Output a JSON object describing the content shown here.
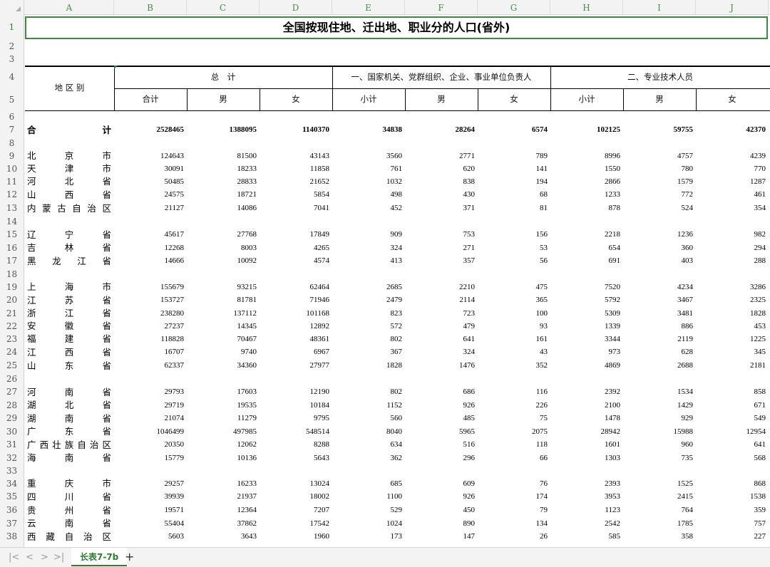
{
  "columns": [
    "A",
    "B",
    "C",
    "D",
    "E",
    "F",
    "G",
    "H",
    "I",
    "J"
  ],
  "row_numbers": [
    "1",
    "2",
    "3",
    "4",
    "5",
    "6",
    "7",
    "8",
    "9",
    "10",
    "11",
    "12",
    "13",
    "14",
    "15",
    "16",
    "17",
    "18",
    "19",
    "20",
    "21",
    "22",
    "23",
    "24",
    "25",
    "26",
    "27",
    "28",
    "29",
    "30",
    "31",
    "32",
    "33",
    "34",
    "35",
    "36",
    "37",
    "38"
  ],
  "title": "全国按现住地、迁出地、职业分的人口(省外)",
  "header": {
    "region_label": "地 区 别",
    "group_total": "总　计",
    "group_1": "一、国家机关、党群组织、企业、事业单位负责人",
    "group_2": "二、专业技术人员",
    "sub": [
      "合计",
      "男",
      "女",
      "小计",
      "男",
      "女",
      "小计",
      "男",
      "女"
    ]
  },
  "total_row": {
    "label_left": "合",
    "label_right": "计",
    "values": [
      "2528465",
      "1388095",
      "1140370",
      "34838",
      "28264",
      "6574",
      "102125",
      "59755",
      "42370"
    ]
  },
  "rows": [
    {
      "chars": [
        "北",
        "京",
        "市"
      ],
      "values": [
        "124643",
        "81500",
        "43143",
        "3560",
        "2771",
        "789",
        "8996",
        "4757",
        "4239"
      ]
    },
    {
      "chars": [
        "天",
        "津",
        "市"
      ],
      "values": [
        "30091",
        "18233",
        "11858",
        "761",
        "620",
        "141",
        "1550",
        "780",
        "770"
      ]
    },
    {
      "chars": [
        "河",
        "北",
        "省"
      ],
      "values": [
        "50485",
        "28833",
        "21652",
        "1032",
        "838",
        "194",
        "2866",
        "1579",
        "1287"
      ]
    },
    {
      "chars": [
        "山",
        "西",
        "省"
      ],
      "values": [
        "24575",
        "18721",
        "5854",
        "498",
        "430",
        "68",
        "1233",
        "772",
        "461"
      ]
    },
    {
      "chars": [
        "内",
        "蒙",
        "古",
        "自",
        "治",
        "区"
      ],
      "values": [
        "21127",
        "14086",
        "7041",
        "452",
        "371",
        "81",
        "878",
        "524",
        "354"
      ]
    },
    {
      "chars": [
        "辽",
        "宁",
        "省"
      ],
      "values": [
        "45617",
        "27768",
        "17849",
        "909",
        "753",
        "156",
        "2218",
        "1236",
        "982"
      ]
    },
    {
      "chars": [
        "吉",
        "林",
        "省"
      ],
      "values": [
        "12268",
        "8003",
        "4265",
        "324",
        "271",
        "53",
        "654",
        "360",
        "294"
      ]
    },
    {
      "chars": [
        "黑",
        "龙",
        "江",
        "省"
      ],
      "values": [
        "14666",
        "10092",
        "4574",
        "413",
        "357",
        "56",
        "691",
        "403",
        "288"
      ]
    },
    {
      "chars": [
        "上",
        "海",
        "市"
      ],
      "values": [
        "155679",
        "93215",
        "62464",
        "2685",
        "2210",
        "475",
        "7520",
        "4234",
        "3286"
      ]
    },
    {
      "chars": [
        "江",
        "苏",
        "省"
      ],
      "values": [
        "153727",
        "81781",
        "71946",
        "2479",
        "2114",
        "365",
        "5792",
        "3467",
        "2325"
      ]
    },
    {
      "chars": [
        "浙",
        "江",
        "省"
      ],
      "values": [
        "238280",
        "137112",
        "101168",
        "823",
        "723",
        "100",
        "5309",
        "3481",
        "1828"
      ]
    },
    {
      "chars": [
        "安",
        "徽",
        "省"
      ],
      "values": [
        "27237",
        "14345",
        "12892",
        "572",
        "479",
        "93",
        "1339",
        "886",
        "453"
      ]
    },
    {
      "chars": [
        "福",
        "建",
        "省"
      ],
      "values": [
        "118828",
        "70467",
        "48361",
        "802",
        "641",
        "161",
        "3344",
        "2119",
        "1225"
      ]
    },
    {
      "chars": [
        "江",
        "西",
        "省"
      ],
      "values": [
        "16707",
        "9740",
        "6967",
        "367",
        "324",
        "43",
        "973",
        "628",
        "345"
      ]
    },
    {
      "chars": [
        "山",
        "东",
        "省"
      ],
      "values": [
        "62337",
        "34360",
        "27977",
        "1828",
        "1476",
        "352",
        "4869",
        "2688",
        "2181"
      ]
    },
    {
      "chars": [
        "河",
        "南",
        "省"
      ],
      "values": [
        "29793",
        "17603",
        "12190",
        "802",
        "686",
        "116",
        "2392",
        "1534",
        "858"
      ]
    },
    {
      "chars": [
        "湖",
        "北",
        "省"
      ],
      "values": [
        "29719",
        "19535",
        "10184",
        "1152",
        "926",
        "226",
        "2100",
        "1429",
        "671"
      ]
    },
    {
      "chars": [
        "湖",
        "南",
        "省"
      ],
      "values": [
        "21074",
        "11279",
        "9795",
        "560",
        "485",
        "75",
        "1478",
        "929",
        "549"
      ]
    },
    {
      "chars": [
        "广",
        "东",
        "省"
      ],
      "values": [
        "1046499",
        "497985",
        "548514",
        "8040",
        "5965",
        "2075",
        "28942",
        "15988",
        "12954"
      ]
    },
    {
      "chars": [
        "广",
        "西",
        "壮",
        "族",
        "自",
        "治",
        "区"
      ],
      "values": [
        "20350",
        "12062",
        "8288",
        "634",
        "516",
        "118",
        "1601",
        "960",
        "641"
      ]
    },
    {
      "chars": [
        "海",
        "南",
        "省"
      ],
      "values": [
        "15779",
        "10136",
        "5643",
        "362",
        "296",
        "66",
        "1303",
        "735",
        "568"
      ]
    },
    {
      "chars": [
        "重",
        "庆",
        "市"
      ],
      "values": [
        "29257",
        "16233",
        "13024",
        "685",
        "609",
        "76",
        "2393",
        "1525",
        "868"
      ]
    },
    {
      "chars": [
        "四",
        "川",
        "省"
      ],
      "values": [
        "39939",
        "21937",
        "18002",
        "1100",
        "926",
        "174",
        "3953",
        "2415",
        "1538"
      ]
    },
    {
      "chars": [
        "贵",
        "州",
        "省"
      ],
      "values": [
        "19571",
        "12364",
        "7207",
        "529",
        "450",
        "79",
        "1123",
        "764",
        "359"
      ]
    },
    {
      "chars": [
        "云",
        "南",
        "省"
      ],
      "values": [
        "55404",
        "37862",
        "17542",
        "1024",
        "890",
        "134",
        "2542",
        "1785",
        "757"
      ]
    },
    {
      "chars": [
        "西",
        "藏",
        "自",
        "治",
        "区"
      ],
      "values": [
        "5603",
        "3643",
        "1960",
        "173",
        "147",
        "26",
        "585",
        "358",
        "227"
      ]
    }
  ],
  "sheet_tab": "长表7-7b",
  "nav_icons": [
    "first-sheet-icon",
    "prev-sheet-icon",
    "next-sheet-icon",
    "last-sheet-icon"
  ],
  "accent_color": "#2e7d32"
}
